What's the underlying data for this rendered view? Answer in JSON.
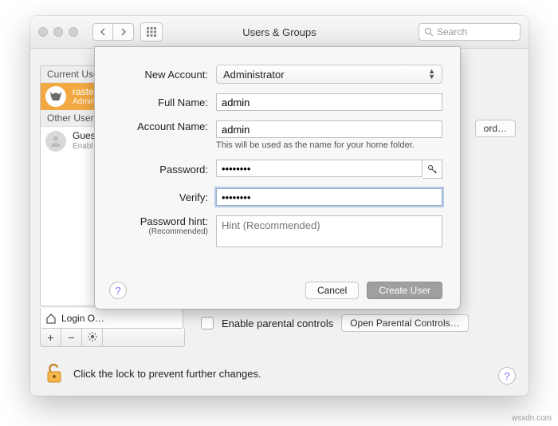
{
  "window": {
    "title": "Users & Groups"
  },
  "toolbar": {
    "search_placeholder": "Search"
  },
  "sidebar": {
    "current_header": "Current User",
    "other_header": "Other Users",
    "current": {
      "name": "raster…",
      "role": "Admin"
    },
    "others": [
      {
        "name": "Gues…",
        "sub": "Enabl…"
      }
    ],
    "login_options": "Login O…"
  },
  "right": {
    "change_password": "ord…",
    "enable_parental": "Enable parental controls",
    "open_parental": "Open Parental Controls…"
  },
  "lock": {
    "text": "Click the lock to prevent further changes."
  },
  "sheet": {
    "labels": {
      "account_type": "New Account:",
      "full_name": "Full Name:",
      "account_name": "Account Name:",
      "password": "Password:",
      "verify": "Verify:",
      "hint": "Password hint:",
      "hint_sub": "(Recommended)"
    },
    "values": {
      "account_type": "Administrator",
      "full_name": "admin",
      "account_name": "admin",
      "password": "••••••••",
      "verify": "••••••••"
    },
    "account_name_hint": "This will be used as the name for your home folder.",
    "hint_placeholder": "Hint (Recommended)",
    "cancel": "Cancel",
    "create": "Create User"
  },
  "watermark": "wsxdn.com"
}
